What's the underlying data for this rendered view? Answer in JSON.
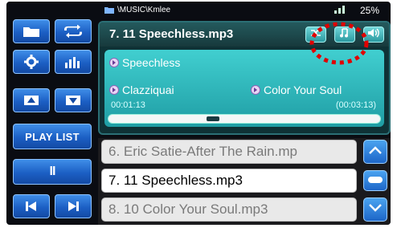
{
  "status": {
    "path": "\\MUSIC\\Kmlee",
    "battery": "25%",
    "signal_icon": "signal-icon"
  },
  "now_playing": {
    "title": "7. 11 Speechless.mp3",
    "song": "Speechless",
    "artist": "Clazziquai",
    "album": "Color Your Soul",
    "elapsed": "00:01:13",
    "total": "(00:03:13)",
    "progress_fraction": 0.38
  },
  "controls": {
    "playlist_label": "PLAY LIST",
    "pause_symbol": "II"
  },
  "playlist": {
    "items": [
      "6. Eric Satie-After The Rain.mp",
      "7. 11 Speechless.mp3",
      "8. 10 Color Your Soul.mp3"
    ]
  },
  "colors": {
    "accent_blue": "#1c5fc4",
    "panel_teal": "#2bb0b4",
    "annotation_red": "#e00000"
  }
}
